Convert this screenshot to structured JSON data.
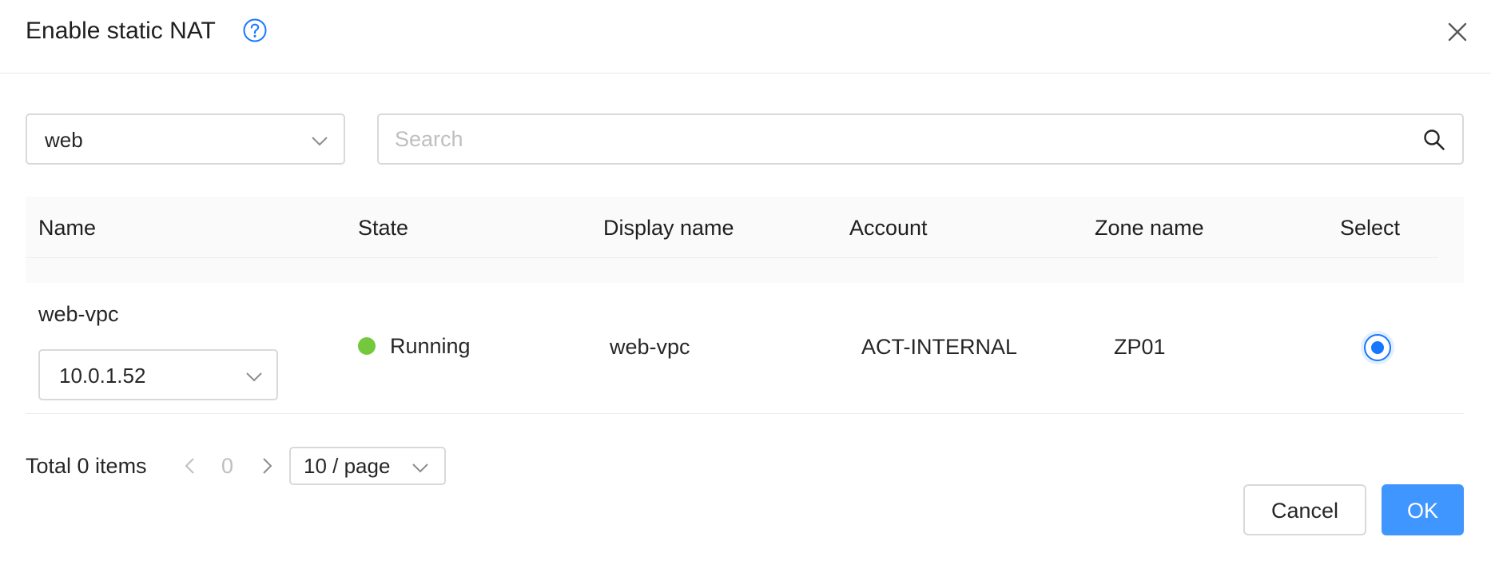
{
  "dialog": {
    "title": "Enable static NAT"
  },
  "filter": {
    "network_value": "web",
    "search_placeholder": "Search"
  },
  "table": {
    "columns": [
      "Name",
      "State",
      "Display name",
      "Account",
      "Zone name",
      "Select"
    ],
    "rows": [
      {
        "name": "web-vpc",
        "ip_value": "10.0.1.52",
        "state": "Running",
        "display_name": "web-vpc",
        "account": "ACT-INTERNAL",
        "zone_name": "ZP01",
        "selected": true
      }
    ]
  },
  "pagination": {
    "total": "Total 0 items",
    "current_page": "0",
    "page_size": "10 / page"
  },
  "footer": {
    "cancel_label": "Cancel",
    "ok_label": "OK"
  },
  "colors": {
    "primary": "#4096ff",
    "running": "#73c83e",
    "border": "#d9d9d9"
  }
}
